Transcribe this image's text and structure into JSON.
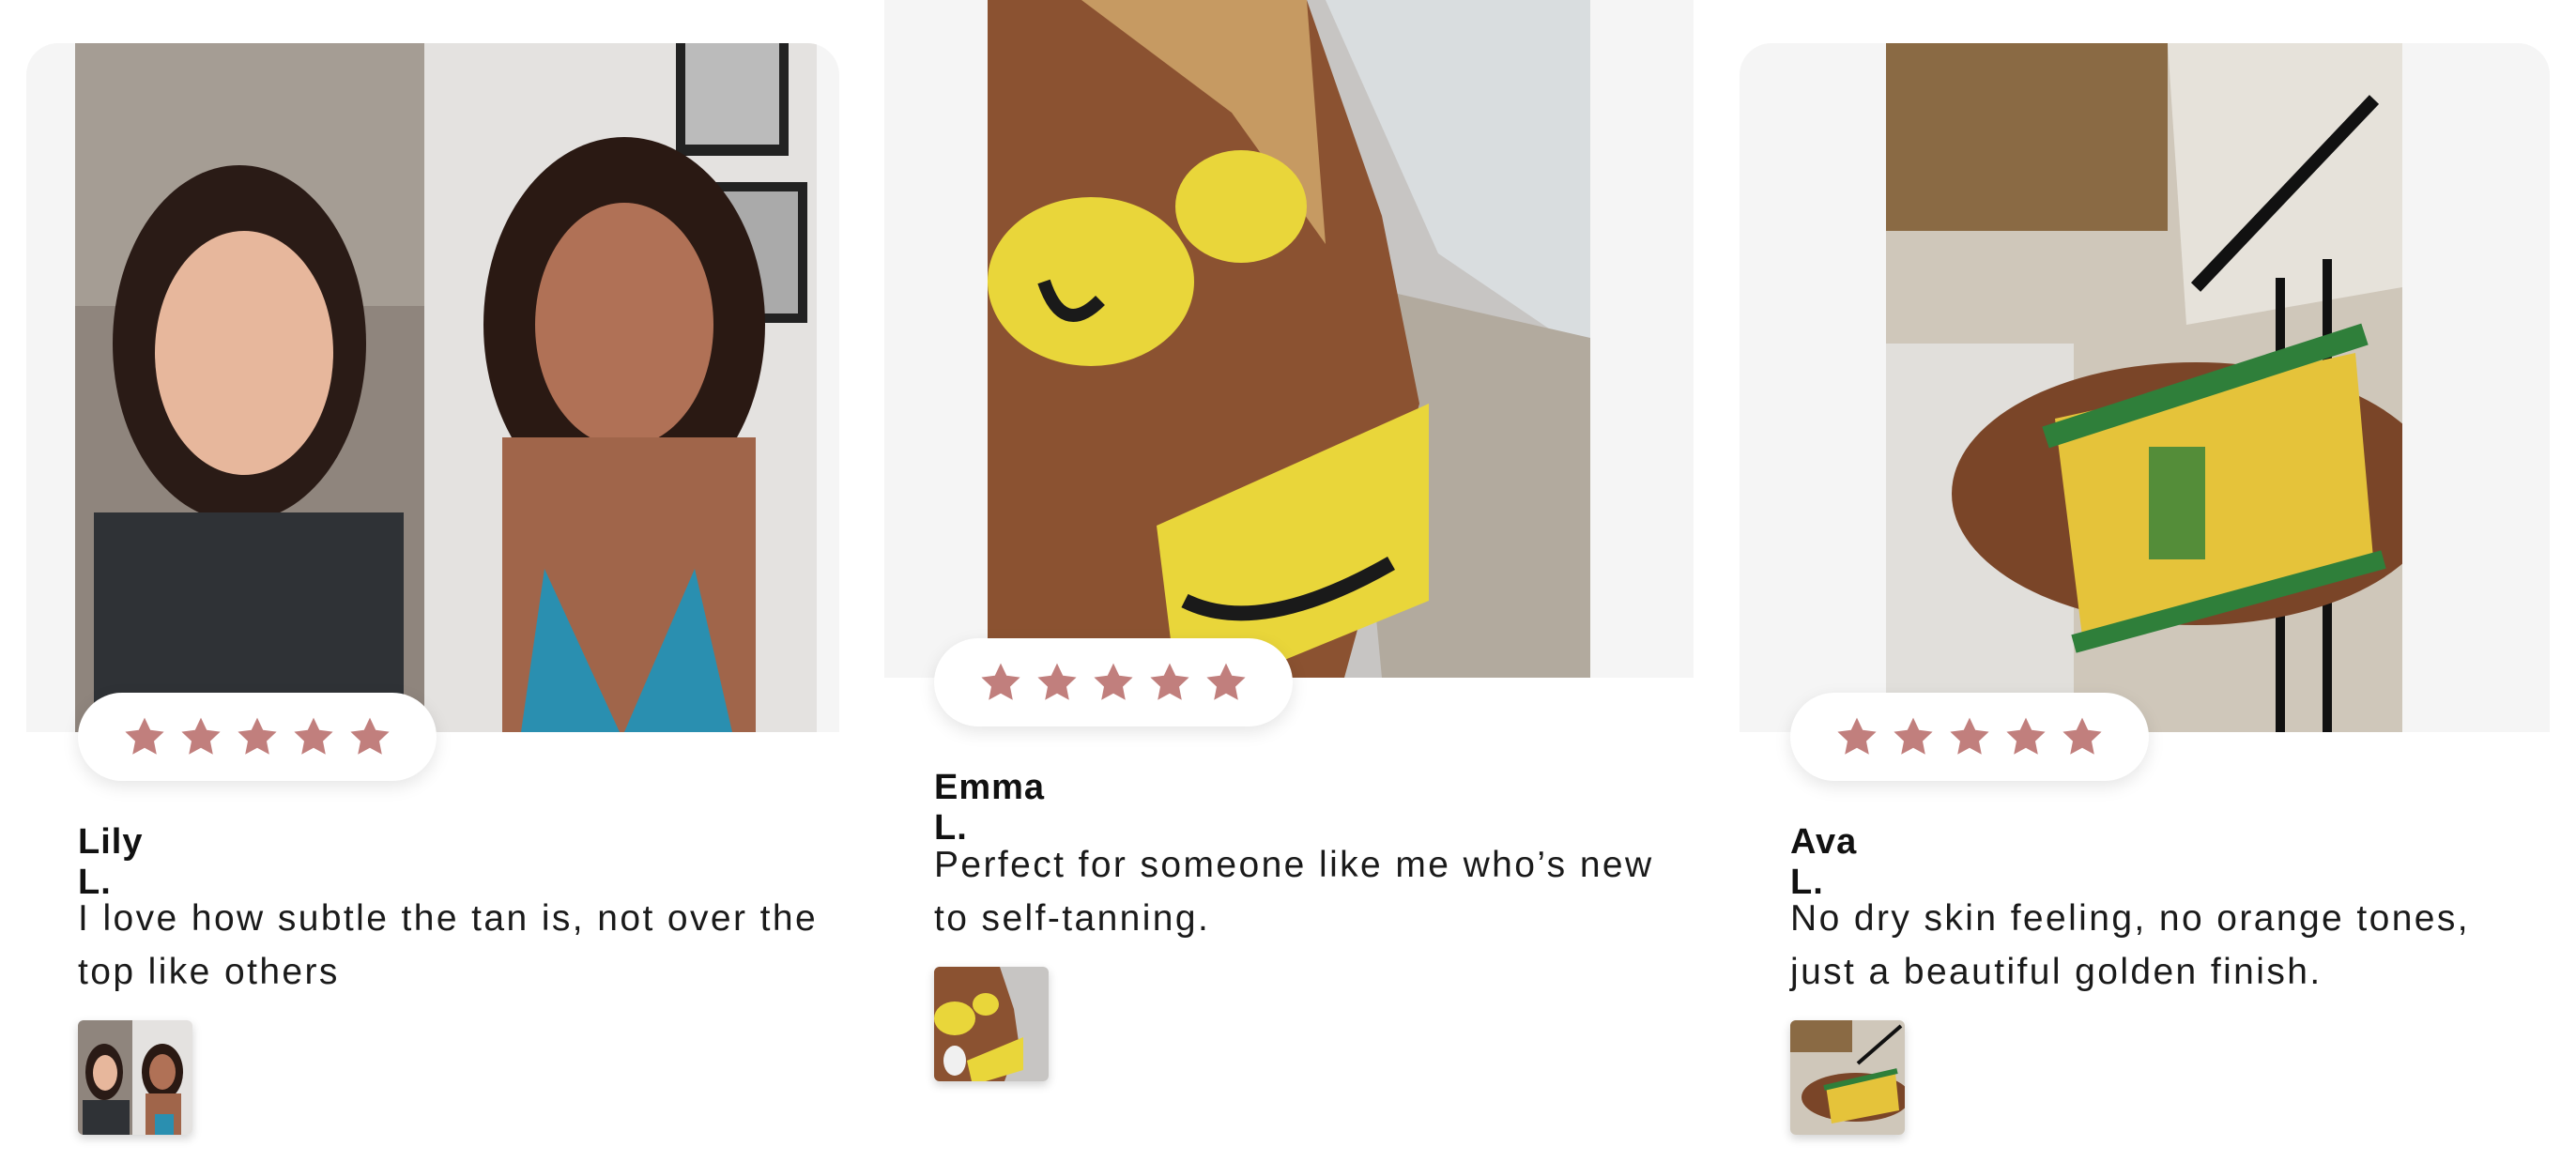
{
  "colors": {
    "star": "#c17f7d",
    "card_bg": "#f5f5f5",
    "text": "#111111"
  },
  "reviews": [
    {
      "name": "Lily L.",
      "rating": 5,
      "text": "I love how subtle the tan is, not over the top like others"
    },
    {
      "name": "Emma L.",
      "rating": 5,
      "text": "Perfect for someone like me who’s new to self-tanning."
    },
    {
      "name": "Ava L.",
      "rating": 5,
      "text": "No dry skin feeling, no orange tones, just a beautiful golden finish."
    }
  ]
}
